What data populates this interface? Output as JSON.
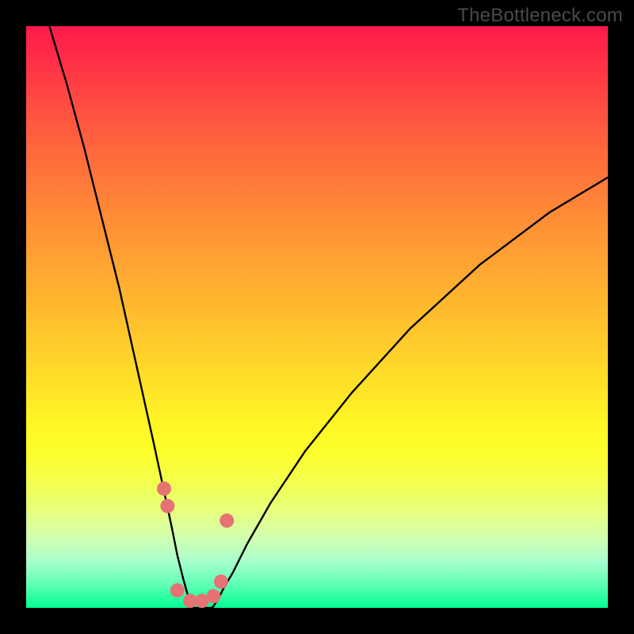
{
  "watermark": "TheBottleneck.com",
  "chart_data": {
    "type": "line",
    "title": "",
    "xlabel": "",
    "ylabel": "",
    "xlim": [
      0,
      100
    ],
    "ylim": [
      0,
      100
    ],
    "grid": false,
    "legend": false,
    "background_gradient": {
      "top_color": "#ff1a4c",
      "bottom_color": "#00ff93",
      "description": "vertical red-to-green gradient (red at top = high bottleneck, green at bottom = low)"
    },
    "series": [
      {
        "name": "bottleneck-curve",
        "color": "#000000",
        "x": [
          4,
          7,
          10,
          13,
          16,
          18,
          20,
          22,
          23.5,
          25,
          26,
          27,
          27.7,
          28.6,
          32,
          33,
          34,
          35.5,
          38,
          42,
          48,
          56,
          66,
          78,
          90,
          100
        ],
        "y": [
          100,
          90,
          79,
          67,
          55,
          46,
          37,
          28,
          21,
          14,
          9,
          5,
          2.5,
          0,
          0,
          1.5,
          3.5,
          6,
          11,
          18,
          27,
          37,
          48,
          59,
          68,
          74
        ]
      }
    ],
    "markers": [
      {
        "x": 23.7,
        "y": 20.5,
        "color": "#e57373"
      },
      {
        "x": 24.3,
        "y": 17.5,
        "color": "#e57373"
      },
      {
        "x": 26.0,
        "y": 3.0,
        "color": "#e57373"
      },
      {
        "x": 28.2,
        "y": 1.2,
        "color": "#e57373"
      },
      {
        "x": 30.2,
        "y": 1.2,
        "color": "#e57373"
      },
      {
        "x": 32.2,
        "y": 2.0,
        "color": "#e57373"
      },
      {
        "x": 33.5,
        "y": 4.5,
        "color": "#e57373"
      },
      {
        "x": 34.5,
        "y": 15.0,
        "color": "#e57373"
      }
    ]
  }
}
